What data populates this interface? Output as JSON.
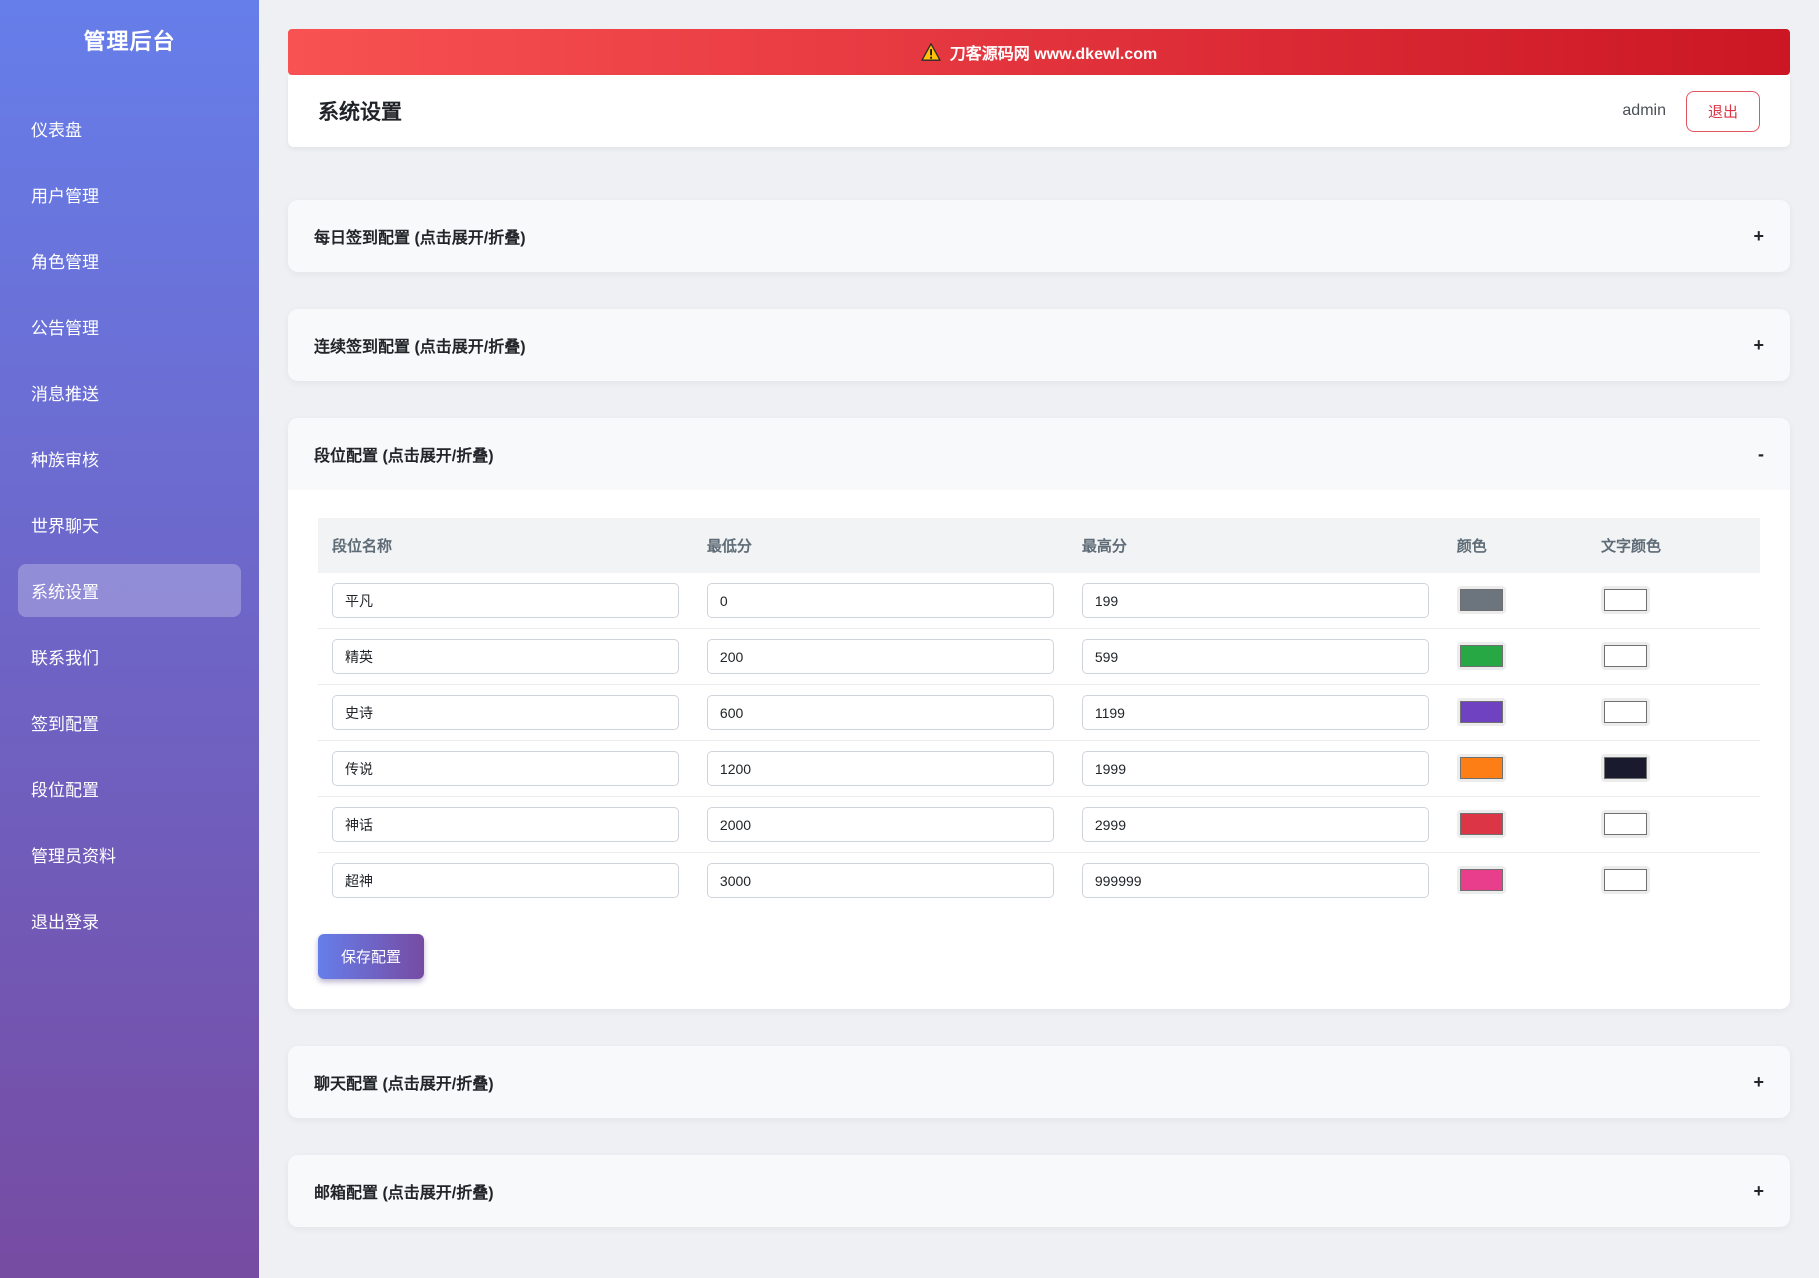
{
  "sidebar": {
    "title": "管理后台",
    "items": [
      {
        "label": "仪表盘",
        "active": false
      },
      {
        "label": "用户管理",
        "active": false
      },
      {
        "label": "角色管理",
        "active": false
      },
      {
        "label": "公告管理",
        "active": false
      },
      {
        "label": "消息推送",
        "active": false
      },
      {
        "label": "种族审核",
        "active": false
      },
      {
        "label": "世界聊天",
        "active": false
      },
      {
        "label": "系统设置",
        "active": true
      },
      {
        "label": "联系我们",
        "active": false
      },
      {
        "label": "签到配置",
        "active": false
      },
      {
        "label": "段位配置",
        "active": false
      },
      {
        "label": "管理员资料",
        "active": false
      },
      {
        "label": "退出登录",
        "active": false
      }
    ]
  },
  "banner": {
    "icon": "warning-triangle",
    "text": "刀客源码网 www.dkewl.com"
  },
  "header": {
    "title": "系统设置",
    "username": "admin",
    "logout_label": "退出"
  },
  "sections": [
    {
      "title": "每日签到配置 (点击展开/折叠)",
      "toggle": "+",
      "expanded": false
    },
    {
      "title": "连续签到配置 (点击展开/折叠)",
      "toggle": "+",
      "expanded": false
    },
    {
      "title": "段位配置 (点击展开/折叠)",
      "toggle": "-",
      "expanded": true
    },
    {
      "title": "聊天配置 (点击展开/折叠)",
      "toggle": "+",
      "expanded": false
    },
    {
      "title": "邮箱配置 (点击展开/折叠)",
      "toggle": "+",
      "expanded": false
    }
  ],
  "rank_table": {
    "columns": [
      "段位名称",
      "最低分",
      "最高分",
      "颜色",
      "文字颜色"
    ],
    "rows": [
      {
        "name": "平凡",
        "min": "0",
        "max": "199",
        "color": "#6c757d",
        "text_color": "#ffffff"
      },
      {
        "name": "精英",
        "min": "200",
        "max": "599",
        "color": "#28a745",
        "text_color": "#ffffff"
      },
      {
        "name": "史诗",
        "min": "600",
        "max": "1199",
        "color": "#6f42c1",
        "text_color": "#ffffff"
      },
      {
        "name": "传说",
        "min": "1200",
        "max": "1999",
        "color": "#fd7e14",
        "text_color": "#1a1a2e"
      },
      {
        "name": "神话",
        "min": "2000",
        "max": "2999",
        "color": "#dc3545",
        "text_color": "#ffffff"
      },
      {
        "name": "超神",
        "min": "3000",
        "max": "999999",
        "color": "#e83e8c",
        "text_color": "#ffffff"
      }
    ],
    "save_label": "保存配置"
  },
  "theme": {
    "sidebar_gradient_top": "#667eea",
    "sidebar_gradient_bottom": "#764ba2",
    "banner_red_left": "#f85252",
    "banner_red_right": "#cb1724",
    "accent_red": "#dc3545",
    "warning_yellow": "#ffc107"
  }
}
